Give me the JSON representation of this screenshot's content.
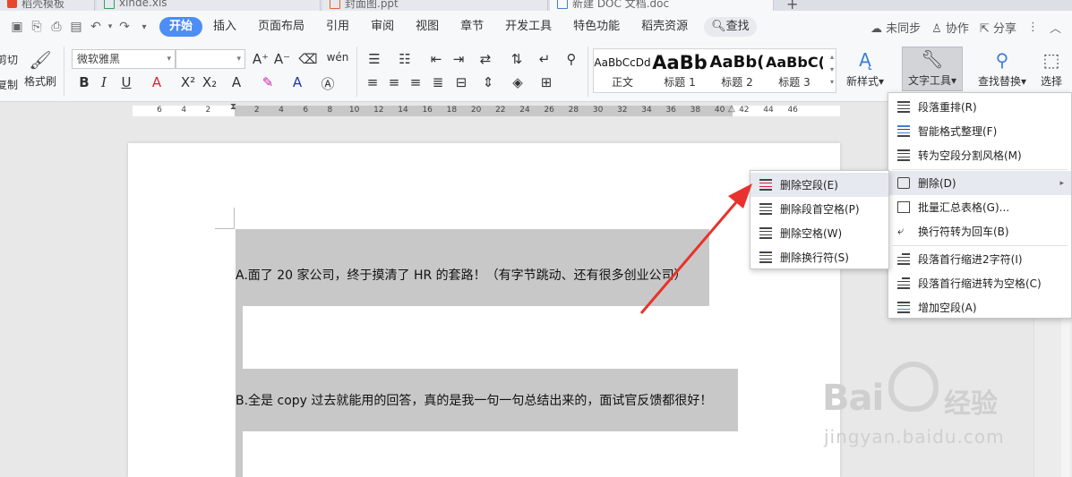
{
  "tabs": [
    {
      "label": "稻壳模板",
      "active": false
    },
    {
      "label": "xlnde.xls",
      "active": false
    },
    {
      "label": "封面图.ppt",
      "active": false
    },
    {
      "label": "新建 DOC 文档.doc",
      "active": true
    }
  ],
  "menubar": {
    "items": [
      "开始",
      "插入",
      "页面布局",
      "引用",
      "审阅",
      "视图",
      "章节",
      "开发工具",
      "特色功能",
      "稻壳资源"
    ],
    "active_index": 0,
    "find": "查找",
    "sync": "未同步",
    "collab": "协作",
    "share": "分享"
  },
  "ribbon": {
    "cut": "剪切",
    "copy": "复制",
    "format_painter": "格式刷",
    "font_name": "微软雅黑",
    "font_size": "",
    "styles": [
      {
        "sample": "AaBbCcDd",
        "name": "正文"
      },
      {
        "sample": "AaBb",
        "name": "标题 1"
      },
      {
        "sample": "AaBb(",
        "name": "标题 2"
      },
      {
        "sample": "AaBbC(",
        "name": "标题 3"
      }
    ],
    "new_style": "新样式",
    "text_tools": "文字工具",
    "find_replace": "查找替换",
    "select": "选择"
  },
  "ruler": {
    "ticks": [
      "6",
      "4",
      "2",
      "",
      "2",
      "4",
      "6",
      "8",
      "10",
      "12",
      "14",
      "16",
      "18",
      "20",
      "22",
      "24",
      "26",
      "28",
      "30",
      "32",
      "34",
      "36",
      "38",
      "40",
      "42",
      "44",
      "46"
    ]
  },
  "document": {
    "para_a": "A.面了 20 家公司，终于摸清了 HR 的套路！（有字节跳动、还有很多创业公司）",
    "para_b": "B.全是 copy 过去就能用的回答，真的是我一句一句总结出来的，面试官反馈都很好！"
  },
  "text_tools_menu": [
    {
      "label": "段落重排(R)",
      "icon": "paragraph-rearrange-icon"
    },
    {
      "label": "智能格式整理(F)",
      "icon": "smart-format-icon"
    },
    {
      "label": "转为空段分割风格(M)",
      "icon": "empty-para-split-icon"
    },
    {
      "label": "删除(D)",
      "icon": "delete-icon",
      "submenu": true
    },
    {
      "label": "批量汇总表格(G)...",
      "icon": "batch-table-icon"
    },
    {
      "label": "换行符转为回车(B)",
      "icon": "linebreak-to-enter-icon"
    },
    {
      "label": "段落首行缩进2字符(I)",
      "icon": "indent-2-chars-icon"
    },
    {
      "label": "段落首行缩进转为空格(C)",
      "icon": "indent-to-spaces-icon"
    },
    {
      "label": "增加空段(A)",
      "icon": "add-empty-para-icon"
    }
  ],
  "delete_submenu": [
    {
      "label": "删除空段(E)",
      "icon": "delete-empty-para-icon"
    },
    {
      "label": "删除段首空格(P)",
      "icon": "delete-leading-spaces-icon"
    },
    {
      "label": "删除空格(W)",
      "icon": "delete-spaces-icon"
    },
    {
      "label": "删除换行符(S)",
      "icon": "delete-linebreak-icon"
    }
  ],
  "watermark": {
    "brand": "Bai",
    "brand2": "经验",
    "url": "jingyan.baidu.com"
  },
  "colors": {
    "accent": "#4c8ef5",
    "arrow": "#e8322d",
    "highlight": "#c8c8c8"
  }
}
